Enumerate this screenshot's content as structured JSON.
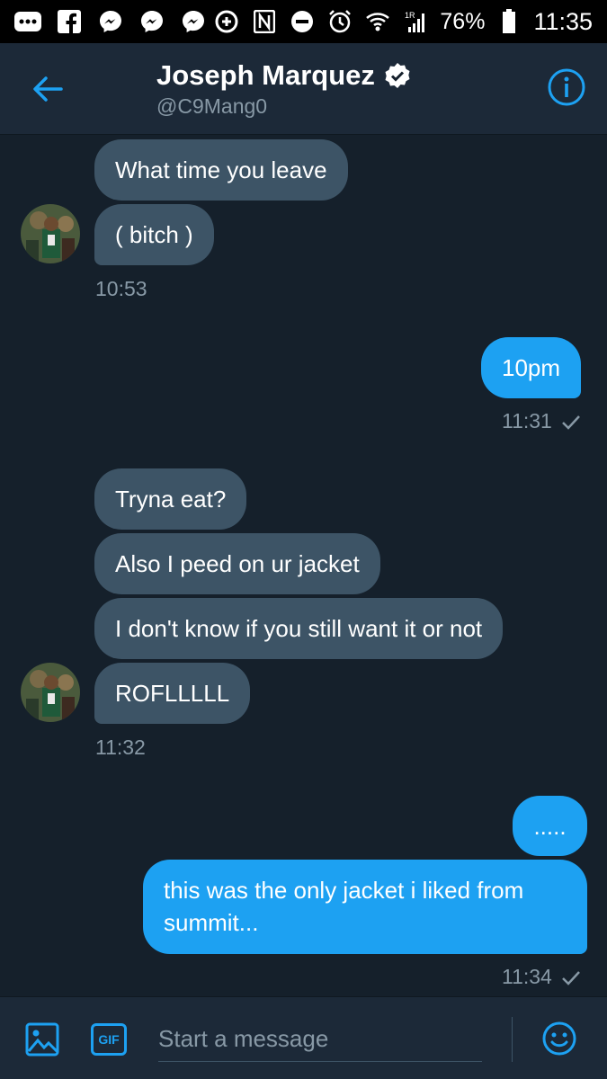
{
  "status_bar": {
    "battery": "76%",
    "time": "11:35",
    "network": "1R"
  },
  "header": {
    "name": "Joseph Marquez",
    "handle": "@C9Mang0"
  },
  "messages": {
    "group1": {
      "m1": "What time you leave",
      "m2": "( bitch )",
      "time": "10:53"
    },
    "group2": {
      "m1": "10pm",
      "time": "11:31"
    },
    "group3": {
      "m1": "Tryna eat?",
      "m2": "Also I peed on ur jacket",
      "m3": "I don't know if you still want it or not",
      "m4": "ROFLLLLL",
      "time": "11:32"
    },
    "group4": {
      "m1": ".....",
      "m2": "this was the only jacket i liked from summit...",
      "time": "11:34"
    }
  },
  "composer": {
    "placeholder": "Start a message",
    "gif_label": "GIF"
  },
  "colors": {
    "background": "#15202b",
    "incoming": "#3d5466",
    "outgoing": "#1da1f2",
    "accent": "#1da1f2"
  }
}
